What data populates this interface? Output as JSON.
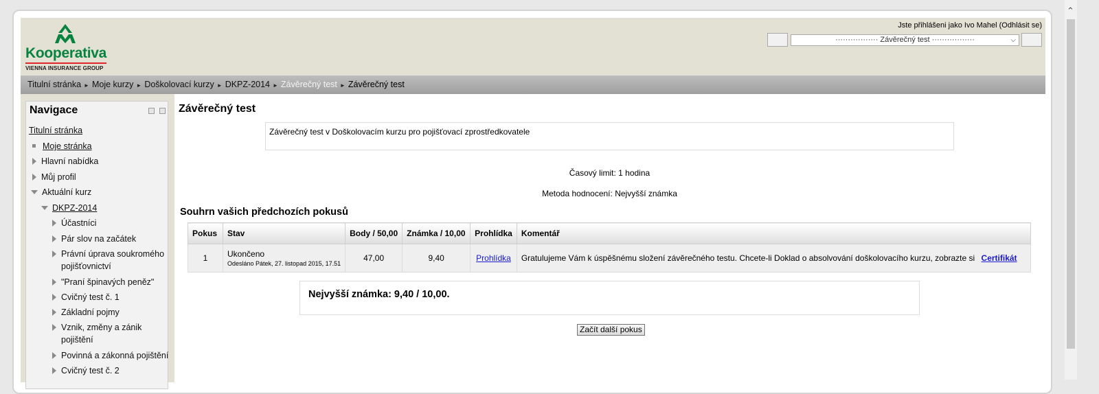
{
  "brand": {
    "name": "Kooperativa",
    "subtitle": "VIENNA INSURANCE GROUP",
    "colors": {
      "green": "#07833f",
      "red": "#e0262b"
    }
  },
  "header": {
    "login_prefix": "Jste přihlášeni jako Ivo Mahel",
    "logout_label": "(Odhlásit se)",
    "jump_selected": "················· Závěrečný test ·················"
  },
  "breadcrumb": [
    "Titulní stránka",
    "Moje kurzy",
    "Doškolovací kurzy",
    "DKPZ-2014",
    "Závěrečný test",
    "Závěrečný test"
  ],
  "navigation": {
    "title": "Navigace",
    "items": [
      "Titulní stránka",
      "Moje stránka",
      "Hlavní nabídka",
      "Můj profil",
      "Aktuální kurz",
      "DKPZ-2014",
      "Účastníci",
      "Pár slov na začátek",
      "Právní úprava soukromého",
      "pojišťovnictví",
      "\"Praní špinavých peněz\"",
      "Cvičný test č. 1",
      "Základní pojmy",
      "Vznik, změny a zánik",
      "pojištění",
      "Povinná a zákonná pojištění",
      "Cvičný test č. 2"
    ]
  },
  "main": {
    "title": "Závěrečný test",
    "intro": "Závěrečný test v Doškolovacím kurzu pro pojišťovací zprostředkovatele",
    "time_limit": "Časový limit: 1 hodina",
    "grading_method": "Metoda hodnocení: Nejvyšší známka",
    "summary_title": "Souhrn vašich předchozích pokusů",
    "table": {
      "headers": [
        "Pokus",
        "Stav",
        "Body / 50,00",
        "Známka / 10,00",
        "Prohlídka",
        "Komentář"
      ],
      "row": {
        "attempt": "1",
        "state": "Ukončeno",
        "submitted": "Odesláno Pátek, 27. listopad 2015, 17.51",
        "points": "47,00",
        "grade": "9,40",
        "review_link": "Prohlídka",
        "comment": "Gratulujeme Vám k úspěšnému složení závěrečného testu. Chcete-li Doklad o absolvování doškolovacího kurzu, zobrazte si",
        "certificate_link": "Certifikát"
      }
    },
    "best_grade": "Nejvyšší známka: 9,40 / 10,00.",
    "start_button": "Začít další pokus"
  }
}
